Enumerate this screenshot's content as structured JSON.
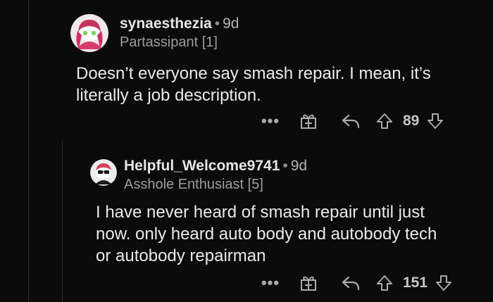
{
  "colors": {
    "background": "#0b0b0b",
    "text": "#e8eaec",
    "muted": "#9a9da0",
    "icon": "#a8abae"
  },
  "comments": [
    {
      "username": "synaesthezia",
      "separator": "•",
      "age": "9d",
      "flair": "Partassipant [1]",
      "body": "Doesn’t everyone say smash repair. I mean, it’s\nliterally a job description.",
      "more_label": "•••",
      "vote_count": "89",
      "icons": [
        "more-icon",
        "gift-icon",
        "reply-icon",
        "upvote-icon",
        "downvote-icon"
      ]
    },
    {
      "username": "Helpful_Welcome9741",
      "separator": "•",
      "age": "9d",
      "flair": "Asshole Enthusiast [5]",
      "body": "I have never heard of smash repair until just\nnow.  only heard auto body and autobody tech\nor autobody repairman",
      "more_label": "•••",
      "vote_count": "151",
      "icons": [
        "more-icon",
        "gift-icon",
        "reply-icon",
        "upvote-icon",
        "downvote-icon"
      ]
    }
  ]
}
